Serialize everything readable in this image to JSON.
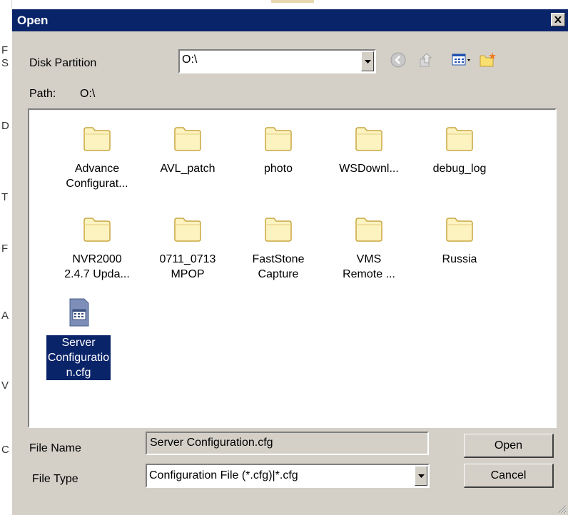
{
  "background": {
    "letters": [
      "F",
      "S",
      "D",
      "T",
      "F",
      "A",
      "V",
      "C"
    ]
  },
  "dialog": {
    "title": "Open",
    "close_icon": "close-icon"
  },
  "disk_partition": {
    "label": "Disk Partition",
    "value": "O:\\"
  },
  "toolbar": {
    "icons": [
      "back-icon",
      "up-folder-icon",
      "view-menu-icon",
      "new-folder-icon"
    ]
  },
  "path": {
    "label": "Path:",
    "value": "O:\\"
  },
  "files": [
    {
      "name": "Advance\nConfigurat...",
      "type": "folder"
    },
    {
      "name": "AVL_patch",
      "type": "folder"
    },
    {
      "name": "photo",
      "type": "folder"
    },
    {
      "name": "WSDownl...",
      "type": "folder"
    },
    {
      "name": "debug_log",
      "type": "folder"
    },
    {
      "name": "NVR2000\n2.4.7 Upda...",
      "type": "folder"
    },
    {
      "name": "0711_0713\nMPOP",
      "type": "folder"
    },
    {
      "name": "FastStone\nCapture",
      "type": "folder"
    },
    {
      "name": "VMS\nRemote ...",
      "type": "folder"
    },
    {
      "name": "Russia",
      "type": "folder"
    },
    {
      "name": "Server\nConfiguratio\nn.cfg",
      "type": "file",
      "selected": true
    }
  ],
  "file_name": {
    "label": "File Name",
    "value": "Server Configuration.cfg"
  },
  "file_type": {
    "label": "File Type",
    "value": "Configuration File (*.cfg)|*.cfg"
  },
  "buttons": {
    "open": "Open",
    "cancel": "Cancel"
  },
  "colors": {
    "title_bar": "#0a246a",
    "selection": "#0a246a",
    "dialog_bg": "#d4d0c8",
    "folder_fill": "#fdf3c0",
    "folder_stroke": "#c9a640"
  }
}
